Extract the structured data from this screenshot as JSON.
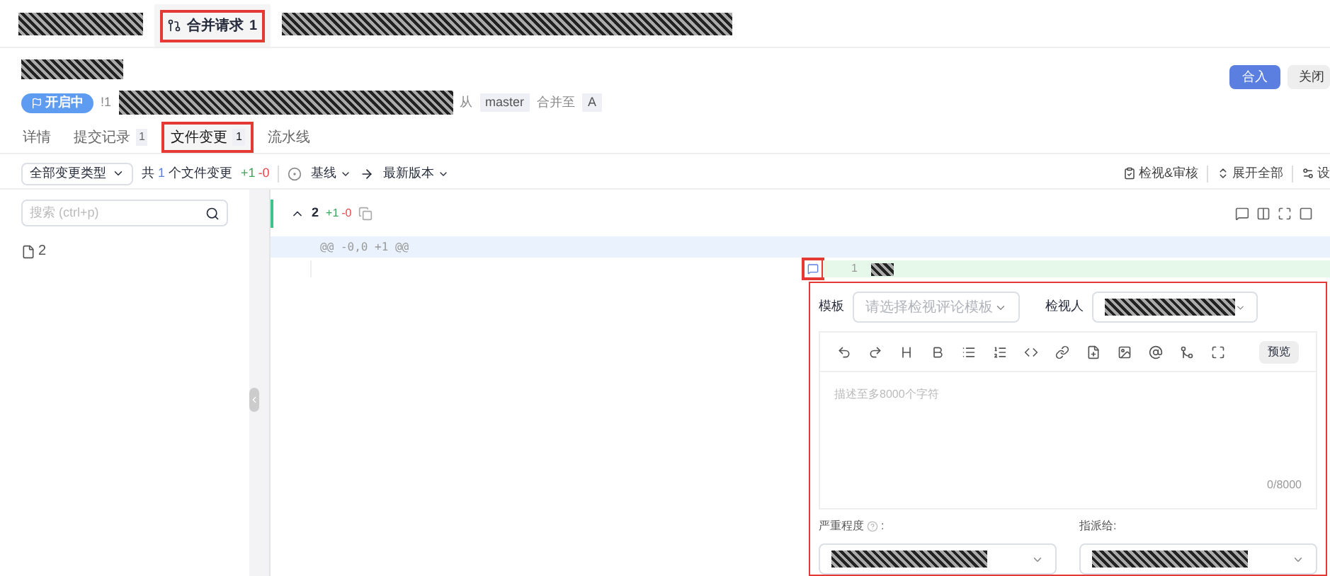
{
  "top_tabs": [
    {
      "kind": "redacted"
    },
    {
      "kind": "tab",
      "label": "合并请求",
      "count": "1",
      "selected": true,
      "highlighted": true
    },
    {
      "kind": "redacted"
    }
  ],
  "header": {
    "status": "开启中",
    "id_prefix": "!1",
    "from_label": "从",
    "source_branch": "master",
    "merge_label": "合并至",
    "target_branch": "A"
  },
  "actions": [
    {
      "label": "合入",
      "kind": "primary"
    },
    {
      "label": "关闭",
      "kind": "secondary"
    }
  ],
  "tabs": [
    {
      "label": "详情",
      "selected": false,
      "highlighted": false
    },
    {
      "label": "提交记录",
      "count": "1",
      "selected": false,
      "highlighted": false
    },
    {
      "label": "文件变更",
      "count": "1",
      "selected": true,
      "highlighted": true
    },
    {
      "label": "流水线",
      "selected": false,
      "highlighted": false
    }
  ],
  "toolbar": {
    "change_type": "全部变更类型",
    "summary_prefix": "共",
    "file_count": "1",
    "summary_suffix": "个文件变更",
    "added": "+1",
    "removed": "-0",
    "base": "基线",
    "target": "最新版本",
    "right_actions": [
      {
        "label": "检视&审核",
        "kind": "review"
      },
      {
        "label": "展开全部",
        "kind": "expand"
      },
      {
        "label": "设",
        "kind": "settings"
      }
    ]
  },
  "file_tree": {
    "search_placeholder": "搜索 (ctrl+p)",
    "files": [
      {
        "name": "2"
      }
    ]
  },
  "diff": {
    "file": "2",
    "added": "+1",
    "removed": "-0",
    "hunk": "@@ -0,0 +1 @@",
    "lines": [
      {
        "number": "1",
        "kind": "added",
        "comment_highlighted": true
      }
    ]
  },
  "comment_form": {
    "highlighted": true,
    "template_label": "模板",
    "template_placeholder": "请选择检视评论模板",
    "reviewer_label": "检视人",
    "preview": "预览",
    "body_placeholder": "描述至多8000个字符",
    "counter": "0/8000",
    "severity_label": "严重程度",
    "label_suffix": ":",
    "assignee_label": "指派给:"
  }
}
